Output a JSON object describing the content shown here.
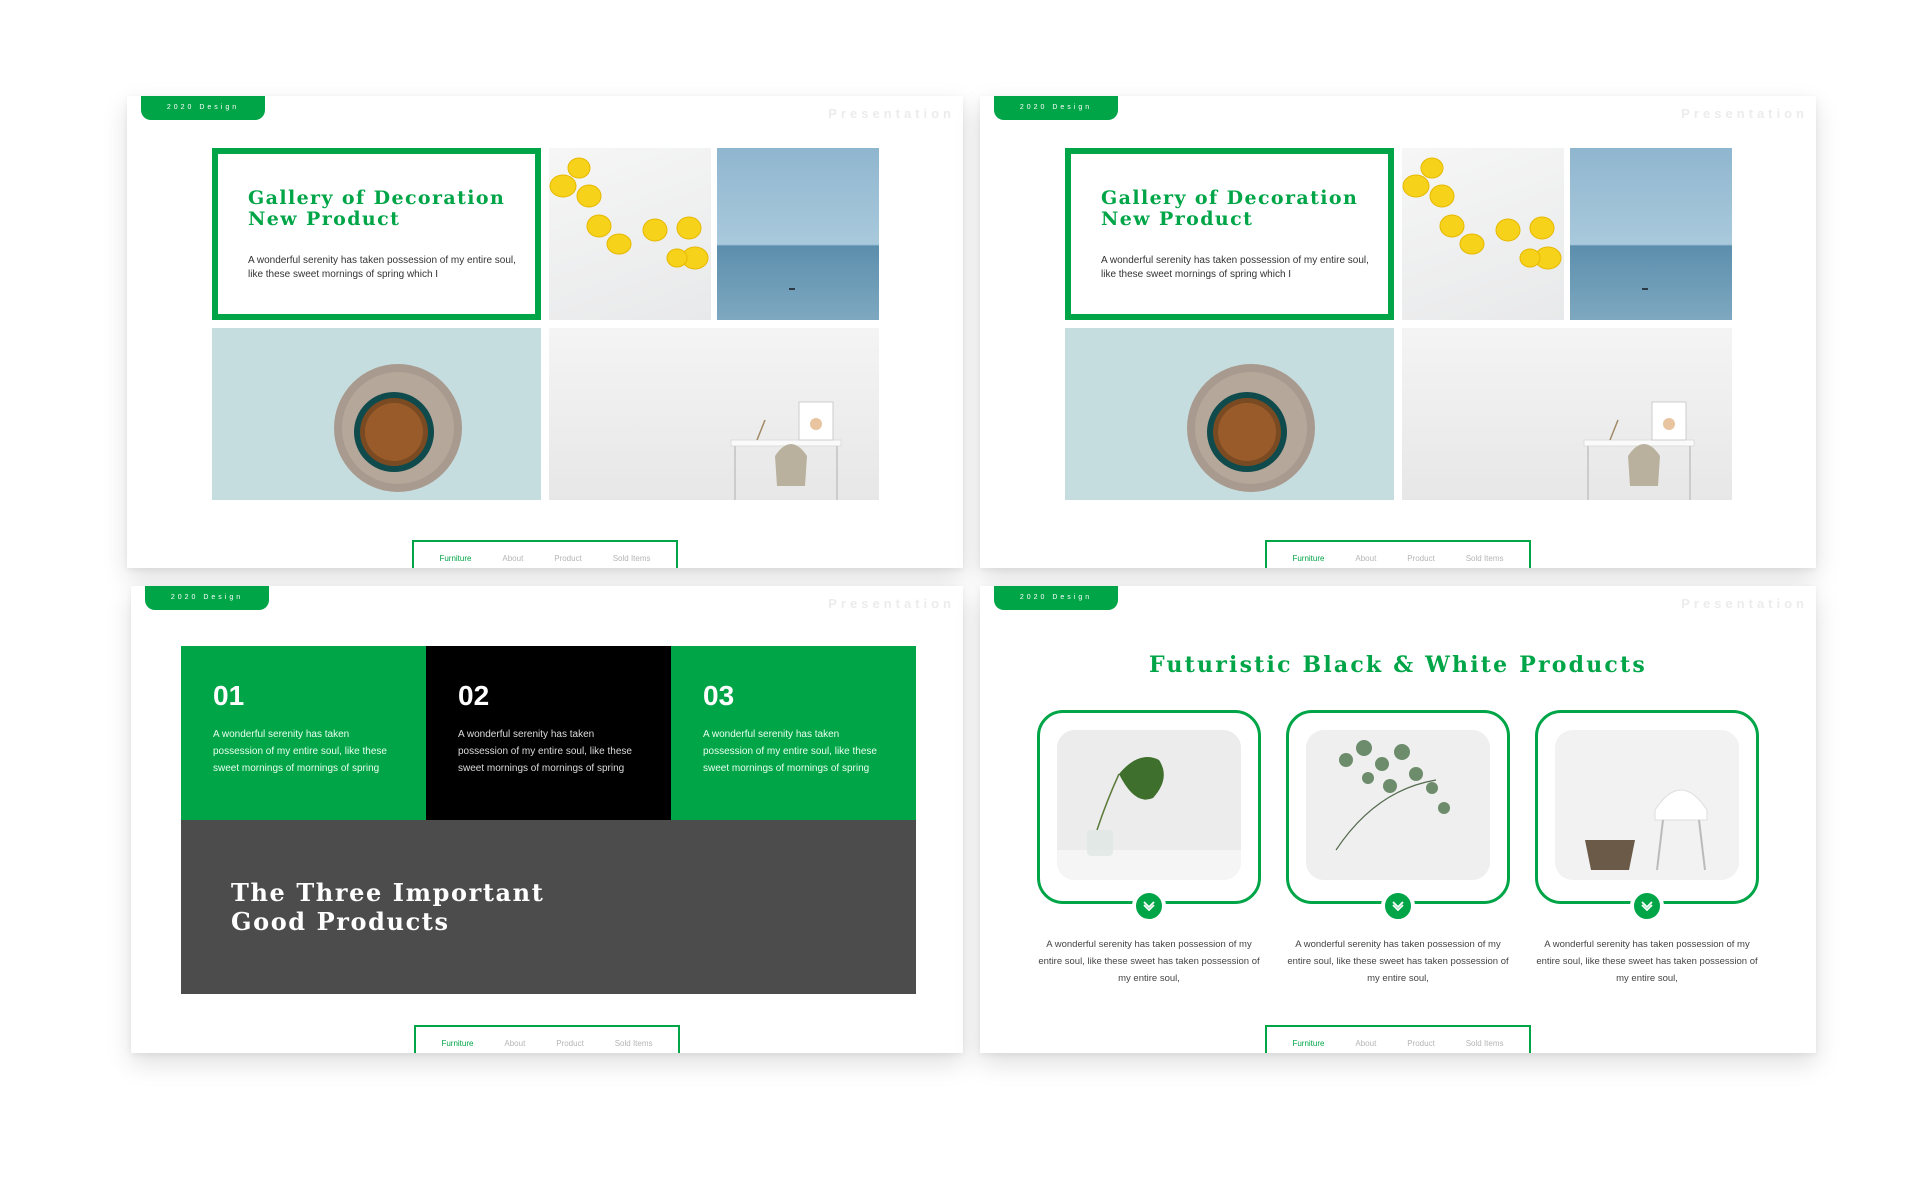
{
  "colors": {
    "accent": "#00a547",
    "dark": "#000000",
    "gray": "#4c4c4c"
  },
  "common": {
    "tag": "2020 Design",
    "watermark": "Presentation",
    "nav": [
      "Furniture",
      "About",
      "Product",
      "Sold Items"
    ]
  },
  "gallery": {
    "title_line1": "Gallery of Decoration",
    "title_line2": "New Product",
    "text": "A wonderful serenity has taken possession of my entire soul, like these sweet mornings of spring which I",
    "images": [
      "lemons",
      "sea",
      "coffee-cup",
      "desk-chair"
    ]
  },
  "important": {
    "boxes": [
      {
        "num": "01",
        "text": "A wonderful serenity has taken possession of my entire soul, like these sweet mornings of mornings of spring"
      },
      {
        "num": "02",
        "text": "A wonderful serenity has taken possession of my entire soul, like these sweet mornings of mornings of spring"
      },
      {
        "num": "03",
        "text": "A wonderful serenity has taken possession of my entire soul, like these sweet mornings of mornings of spring"
      }
    ],
    "title_line1": "The Three Important",
    "title_line2": "Good Products"
  },
  "futuristic": {
    "title": "Futuristic Black & White Products",
    "cards": [
      {
        "image": "monstera-leaf",
        "text": "A wonderful serenity has taken possession of my entire soul, like these sweet has taken possession of my entire soul,"
      },
      {
        "image": "eucalyptus",
        "text": "A wonderful serenity has taken possession of my entire soul, like these sweet has taken possession of my entire soul,"
      },
      {
        "image": "white-chair",
        "text": "A wonderful serenity has taken possession of my entire soul, like these sweet has taken possession of my entire soul,"
      }
    ]
  }
}
